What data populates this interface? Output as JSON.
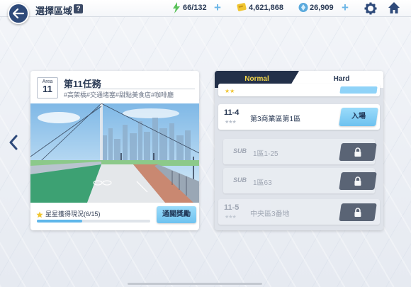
{
  "header": {
    "title": "選擇區域",
    "help": "?",
    "stamina": "66/132",
    "credits": "4,621,868",
    "gems": "26,909"
  },
  "mission_card": {
    "area_label": "Area",
    "area_number": "11",
    "title": "第11任務",
    "tags": "#高架橋#交通堵塞#甜點美食店#咖啡廳",
    "star_progress_label": "星星獲得現況(6/15)",
    "star_progress": 0.4,
    "reward_button": "通關獎勵"
  },
  "stage_panel": {
    "tabs": [
      "Normal",
      "Hard"
    ],
    "active_tab": "Normal",
    "stages": [
      {
        "num": "11-4",
        "name": "第3商業區第1區",
        "action": "入場",
        "locked": false,
        "stars": "★★★"
      },
      {
        "num": "SUB",
        "name": "1區1-25",
        "locked": true,
        "stars": ""
      },
      {
        "num": "SUB",
        "name": "1區63",
        "locked": true,
        "stars": ""
      },
      {
        "num": "11-5",
        "name": "中央區3番地",
        "locked": true,
        "stars": "★★★"
      }
    ]
  },
  "colors": {
    "accent_blue": "#6ec2ef",
    "dark_navy": "#233049",
    "tab_gold": "#f3d649"
  }
}
